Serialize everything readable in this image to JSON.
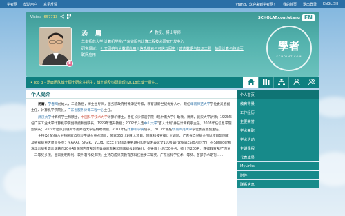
{
  "topbar": {
    "left": [
      "学者网",
      "帮助用户",
      "意见反馈"
    ],
    "welcome": "ytang，欢迎来到学者网！",
    "right": [
      "我的首页",
      "退出登录",
      "ENGLISH"
    ]
  },
  "header": {
    "visits_label": "Visits:",
    "visits_count": "657713",
    "site": "SCHOLAT.com/ytang",
    "en_label": "EN",
    "name": "汤  庸",
    "titles": "教授、博士导师",
    "affiliation": "华南师范大学  计算机学院/广东省服务计算工程技术研究开发中心",
    "fields_label": "研究领域：",
    "fields": [
      "社交网络与大数据应用",
      "信息搜索与可信云服务",
      "时态数据与知识工程",
      "协同计算与移动互联网应用"
    ],
    "avatar_badge": "8",
    "seal": {
      "big": "學者",
      "small": "SCHOLAT.COM"
    }
  },
  "ticker": "Top 3 - 汤庸团队博士硕士研究生招生，博士后及科研助理 [2018年博士招生...",
  "nav_icons": [
    "home-icon",
    "books-icon",
    "org-chart-icon",
    "person-icon",
    "group-icon"
  ],
  "main": {
    "section_title": "个人简介",
    "p1": {
      "name": "汤庸",
      "t1": "，",
      "site": "学者网",
      "t2": "创始人，二级教授，博士生导师，国务院政府特殊津贴专家，教育部新世纪优秀人才。现任",
      "org1": "华南师范大学",
      "t3": "学位委员会副主任、计算机学院院长，",
      "org2": "广东省服务计算工程中心",
      "t4": "主任。"
    },
    "p2": {
      "u1": "武汉大学",
      "t1": "计算机学士和硕士，",
      "u2": "中国科学技术大学",
      "t2": "计算机博士。曾任长沙铁道学院（现中南大学）助教、讲师，武汉大学讲师；1995年任广东工业大学计算机学院副教授和副院长，1999年晋升教授；2002年入选",
      "u3": "中山大学",
      "t3": "\"百人计划\"并任计算机系主任，2003年任信息学院副院长；2009年团队引进到华南师范大学任特聘教授，2011年任",
      "u4": "计算机学院",
      "t4": "院长，2013年兼任",
      "u5": "华南师范大学",
      "t5": "学位委员会副主任。"
    },
    "p3": "主持及(含)联合主持国家自然科学基金重点项目、国家863计划重大项目、国家科技支撑计划课题、广东省自然基金团队项目等国家及省部级重大项目多项；在AAAI、SIGIR、VLDB、IEEE Trans等重要期刊和会议发表论文100多篇(含多篇ESI高引论文)；在Springer和清华出版社等出版著作20多部(含国内首部时态数据库专著和国家级规划教材)；指导博士(后)30多名、硕士近200名，获得教育部/广东省一二等奖多项，国家发明专利、软件著作权多项；主持的成果获教育部科技进步二等奖、广东省科学技术一等奖、首部学术期刊……"
  },
  "sidebar": [
    "个人首页",
    "教育背景",
    "工作经历",
    "主要荣誉",
    "学术兼职",
    "学术活动",
    "主讲课程",
    "代表成果",
    "MyLinks",
    "附件",
    "联系信息"
  ]
}
